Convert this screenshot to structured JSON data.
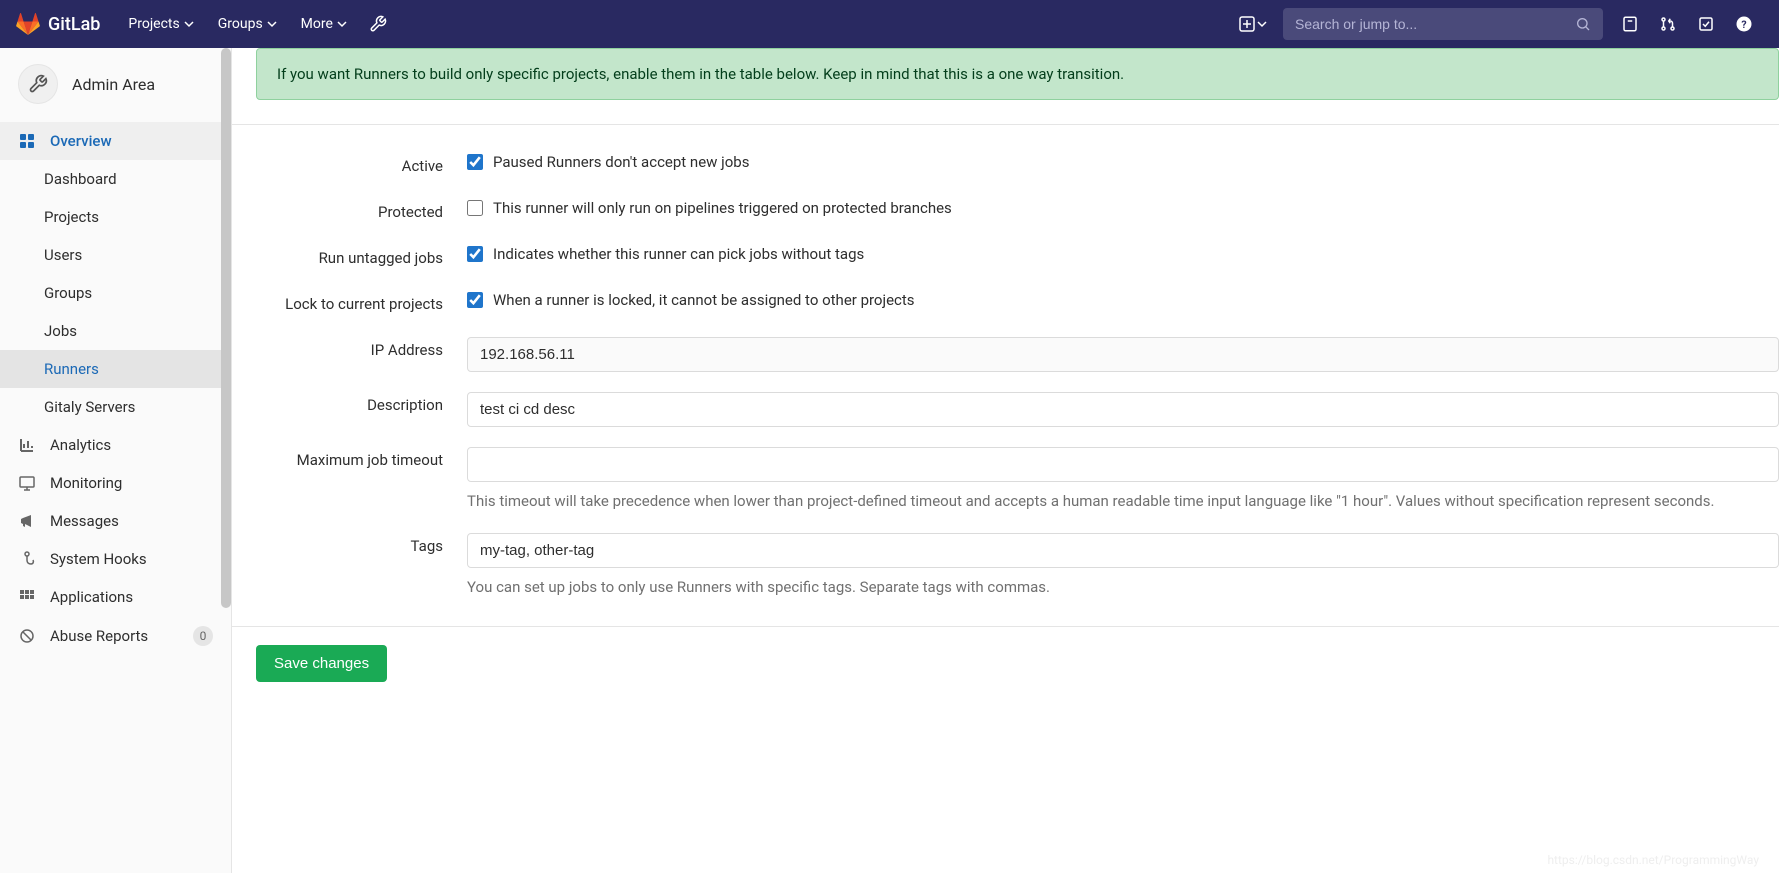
{
  "navbar": {
    "brand": "GitLab",
    "items": [
      "Projects",
      "Groups",
      "More"
    ],
    "search_placeholder": "Search or jump to..."
  },
  "sidebar": {
    "title": "Admin Area",
    "sections": {
      "overview": {
        "label": "Overview",
        "items": [
          "Dashboard",
          "Projects",
          "Users",
          "Groups",
          "Jobs",
          "Runners",
          "Gitaly Servers"
        ]
      },
      "analytics": "Analytics",
      "monitoring": "Monitoring",
      "messages": "Messages",
      "system_hooks": "System Hooks",
      "applications": "Applications",
      "abuse_reports": {
        "label": "Abuse Reports",
        "badge": "0"
      }
    }
  },
  "alert": "If you want Runners to build only specific projects, enable them in the table below. Keep in mind that this is a one way transition.",
  "form": {
    "active": {
      "label": "Active",
      "text": "Paused Runners don't accept new jobs",
      "checked": true
    },
    "protected": {
      "label": "Protected",
      "text": "This runner will only run on pipelines triggered on protected branches",
      "checked": false
    },
    "run_untagged": {
      "label": "Run untagged jobs",
      "text": "Indicates whether this runner can pick jobs without tags",
      "checked": true
    },
    "lock": {
      "label": "Lock to current projects",
      "text": "When a runner is locked, it cannot be assigned to other projects",
      "checked": true
    },
    "ip": {
      "label": "IP Address",
      "value": "192.168.56.11"
    },
    "description": {
      "label": "Description",
      "value": "test ci cd desc"
    },
    "timeout": {
      "label": "Maximum job timeout",
      "value": "",
      "help": "This timeout will take precedence when lower than project-defined timeout and accepts a human readable time input language like \"1 hour\". Values without specification represent seconds."
    },
    "tags": {
      "label": "Tags",
      "value": "my-tag, other-tag",
      "help": "You can set up jobs to only use Runners with specific tags. Separate tags with commas."
    },
    "save": "Save changes"
  },
  "watermark": "https://blog.csdn.net/ProgrammingWay"
}
